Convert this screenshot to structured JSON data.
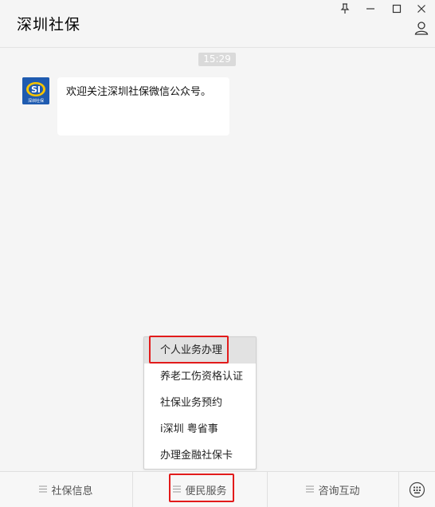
{
  "header": {
    "title": "深圳社保",
    "controls": [
      "pin-icon",
      "minimize-icon",
      "maximize-icon",
      "close-icon"
    ],
    "profile_icon": "person-icon"
  },
  "chat": {
    "timestamp": "15:29",
    "messages": [
      {
        "sender_avatar": "shenzhen-social-security-logo",
        "avatar_caption": "深圳社保",
        "text": "欢迎关注深圳社保微信公众号。"
      }
    ]
  },
  "popup_menu": {
    "items": [
      {
        "label": "个人业务办理",
        "selected": true
      },
      {
        "label": "养老工伤资格认证"
      },
      {
        "label": "社保业务预约"
      },
      {
        "label": "i深圳 粤省事"
      },
      {
        "label": "办理金融社保卡"
      }
    ]
  },
  "bottom_menu": {
    "tabs": [
      {
        "label": "社保信息"
      },
      {
        "label": "便民服务",
        "active": true
      },
      {
        "label": "咨询互动"
      }
    ],
    "keyboard_icon": "keyboard-icon"
  },
  "colors": {
    "highlight_border": "#e21b1b",
    "avatar_blue": "#1f5bb0",
    "logo_yellow": "#f6c400"
  }
}
